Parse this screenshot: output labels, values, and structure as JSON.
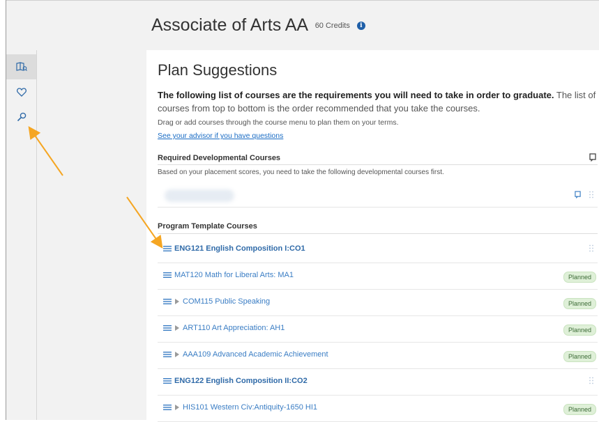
{
  "header": {
    "program_title": "Associate of Arts AA",
    "credits": "60 Credits",
    "info_glyph": "i"
  },
  "rail": {
    "items": [
      {
        "icon": "book-map-icon",
        "active": true
      },
      {
        "icon": "heart-icon",
        "active": false
      },
      {
        "icon": "search-icon",
        "active": false
      }
    ]
  },
  "plan": {
    "title": "Plan Suggestions",
    "intro_bold": "The following list of courses are the requirements you will need to take in order to graduate.",
    "intro_rest": " The list of courses from top to bottom is the order recommended that you take the courses.",
    "drag_note": "Drag or add courses through the course menu to plan them on your terms.",
    "advisor_link": "See your advisor if you have questions"
  },
  "developmental": {
    "heading": "Required Developmental Courses",
    "description": "Based on your placement scores, you need to take the following developmental courses first."
  },
  "program_template": {
    "heading": "Program Template Courses",
    "courses": [
      {
        "label": "ENG121 English Composition I:CO1",
        "bold": true,
        "expandable": false,
        "status": ""
      },
      {
        "label": "MAT120 Math for Liberal Arts: MA1",
        "bold": false,
        "expandable": false,
        "status": "Planned"
      },
      {
        "label": "COM115 Public Speaking",
        "bold": false,
        "expandable": true,
        "status": "Planned"
      },
      {
        "label": "ART110 Art Appreciation: AH1",
        "bold": false,
        "expandable": true,
        "status": "Planned"
      },
      {
        "label": "AAA109 Advanced Academic Achievement",
        "bold": false,
        "expandable": true,
        "status": "Planned"
      },
      {
        "label": "ENG122 English Composition II:CO2",
        "bold": true,
        "expandable": false,
        "status": ""
      },
      {
        "label": "HIS101 Western Civ:Antiquity-1650 HI1",
        "bold": false,
        "expandable": true,
        "status": "Planned"
      }
    ]
  },
  "colors": {
    "link_blue": "#3a7dc4",
    "badge_green": "#dff0d8",
    "annotation_arrow": "#f5a623"
  }
}
